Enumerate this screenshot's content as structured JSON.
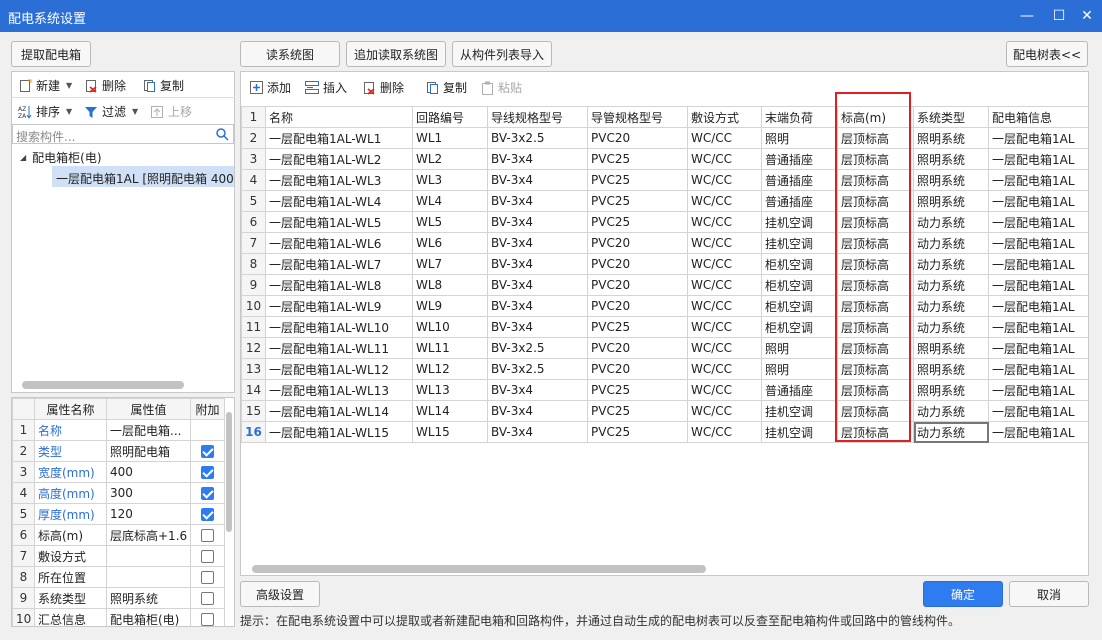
{
  "window": {
    "title": "配电系统设置",
    "minimize": "—",
    "maximize": "☐",
    "close": "✕"
  },
  "left": {
    "extract_button": "提取配电箱",
    "toolbar": {
      "new": "新建",
      "delete": "删除",
      "copy": "复制",
      "sort": "排序",
      "filter": "过滤",
      "up": "上移"
    },
    "search_placeholder": "搜索构件...",
    "tree": {
      "root": "配电箱柜(电)",
      "child": "一层配电箱1AL [照明配电箱 400"
    },
    "props": {
      "headers": [
        "",
        "属性名称",
        "属性值",
        "附加"
      ],
      "rows": [
        {
          "n": "1",
          "name": "名称",
          "value": "一层配电箱...",
          "blue": true,
          "check": null
        },
        {
          "n": "2",
          "name": "类型",
          "value": "照明配电箱",
          "blue": true,
          "check": true
        },
        {
          "n": "3",
          "name": "宽度(mm)",
          "value": "400",
          "blue": true,
          "check": true
        },
        {
          "n": "4",
          "name": "高度(mm)",
          "value": "300",
          "blue": true,
          "check": true
        },
        {
          "n": "5",
          "name": "厚度(mm)",
          "value": "120",
          "blue": true,
          "check": true
        },
        {
          "n": "6",
          "name": "标高(m)",
          "value": "层底标高+1.6",
          "blue": false,
          "check": false
        },
        {
          "n": "7",
          "name": "敷设方式",
          "value": "",
          "blue": false,
          "check": false
        },
        {
          "n": "8",
          "name": "所在位置",
          "value": "",
          "blue": false,
          "check": false
        },
        {
          "n": "9",
          "name": "系统类型",
          "value": "照明系统",
          "blue": false,
          "check": false
        },
        {
          "n": "10",
          "name": "汇总信息",
          "value": "配电箱柜(电)",
          "blue": false,
          "check": false
        }
      ]
    }
  },
  "top_buttons": {
    "read_system": "读系统图",
    "append_read": "追加读取系统图",
    "import_list": "从构件列表导入",
    "tree_toggle": "配电树表<<"
  },
  "grid_toolbar": {
    "add": "添加",
    "insert": "插入",
    "delete": "删除",
    "copy": "复制",
    "paste": "粘贴"
  },
  "grid": {
    "headers": [
      "名称",
      "回路编号",
      "导线规格型号",
      "导管规格型号",
      "敷设方式",
      "末端负荷",
      "标高(m)",
      "系统类型",
      "配电箱信息"
    ],
    "rows": [
      [
        "一层配电箱1AL-WL1",
        "WL1",
        "BV-3x2.5",
        "PVC20",
        "WC/CC",
        "照明",
        "层顶标高",
        "照明系统",
        "一层配电箱1AL"
      ],
      [
        "一层配电箱1AL-WL2",
        "WL2",
        "BV-3x4",
        "PVC25",
        "WC/CC",
        "普通插座",
        "层顶标高",
        "照明系统",
        "一层配电箱1AL"
      ],
      [
        "一层配电箱1AL-WL3",
        "WL3",
        "BV-3x4",
        "PVC25",
        "WC/CC",
        "普通插座",
        "层顶标高",
        "照明系统",
        "一层配电箱1AL"
      ],
      [
        "一层配电箱1AL-WL4",
        "WL4",
        "BV-3x4",
        "PVC25",
        "WC/CC",
        "普通插座",
        "层顶标高",
        "照明系统",
        "一层配电箱1AL"
      ],
      [
        "一层配电箱1AL-WL5",
        "WL5",
        "BV-3x4",
        "PVC25",
        "WC/CC",
        "挂机空调",
        "层顶标高",
        "动力系统",
        "一层配电箱1AL"
      ],
      [
        "一层配电箱1AL-WL6",
        "WL6",
        "BV-3x4",
        "PVC20",
        "WC/CC",
        "挂机空调",
        "层顶标高",
        "动力系统",
        "一层配电箱1AL"
      ],
      [
        "一层配电箱1AL-WL7",
        "WL7",
        "BV-3x4",
        "PVC20",
        "WC/CC",
        "柜机空调",
        "层顶标高",
        "动力系统",
        "一层配电箱1AL"
      ],
      [
        "一层配电箱1AL-WL8",
        "WL8",
        "BV-3x4",
        "PVC20",
        "WC/CC",
        "柜机空调",
        "层顶标高",
        "动力系统",
        "一层配电箱1AL"
      ],
      [
        "一层配电箱1AL-WL9",
        "WL9",
        "BV-3x4",
        "PVC20",
        "WC/CC",
        "柜机空调",
        "层顶标高",
        "动力系统",
        "一层配电箱1AL"
      ],
      [
        "一层配电箱1AL-WL10",
        "WL10",
        "BV-3x4",
        "PVC25",
        "WC/CC",
        "柜机空调",
        "层顶标高",
        "动力系统",
        "一层配电箱1AL"
      ],
      [
        "一层配电箱1AL-WL11",
        "WL11",
        "BV-3x2.5",
        "PVC20",
        "WC/CC",
        "照明",
        "层顶标高",
        "照明系统",
        "一层配电箱1AL"
      ],
      [
        "一层配电箱1AL-WL12",
        "WL12",
        "BV-3x2.5",
        "PVC20",
        "WC/CC",
        "照明",
        "层顶标高",
        "照明系统",
        "一层配电箱1AL"
      ],
      [
        "一层配电箱1AL-WL13",
        "WL13",
        "BV-3x4",
        "PVC25",
        "WC/CC",
        "普通插座",
        "层顶标高",
        "照明系统",
        "一层配电箱1AL"
      ],
      [
        "一层配电箱1AL-WL14",
        "WL14",
        "BV-3x4",
        "PVC25",
        "WC/CC",
        "挂机空调",
        "层顶标高",
        "动力系统",
        "一层配电箱1AL"
      ],
      [
        "一层配电箱1AL-WL15",
        "WL15",
        "BV-3x4",
        "PVC25",
        "WC/CC",
        "挂机空调",
        "层顶标高",
        "动力系统",
        "一层配电箱1AL"
      ]
    ]
  },
  "bottom": {
    "advanced": "高级设置",
    "ok": "确定",
    "cancel": "取消",
    "hint": "提示：在配电系统设置中可以提取或者新建配电箱和回路构件，并通过自动生成的配电树表可以反查至配电箱构件或回路中的管线构件。"
  },
  "colors": {
    "accent": "#2b6fd6",
    "highlight_box": "#e02020",
    "selection": "#cfe0f7"
  }
}
